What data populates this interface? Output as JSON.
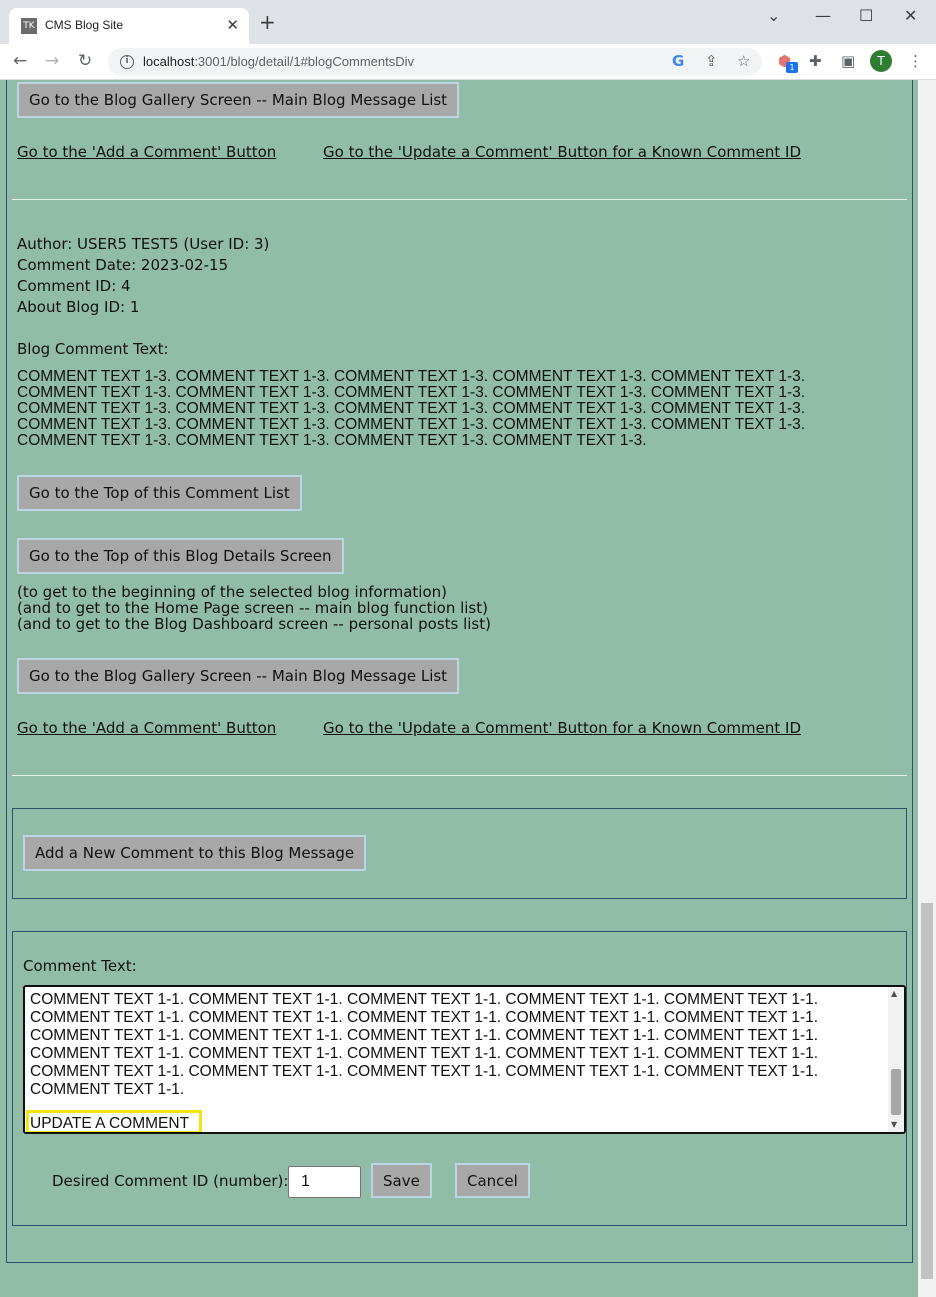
{
  "browser": {
    "tab_title": "CMS Blog Site",
    "tab_favicon": "TK",
    "url_host": "localhost",
    "url_rest": ":3001/blog/detail/1#blogCommentsDiv",
    "profile_initial": "T",
    "extension_badge": "1"
  },
  "nav_top": {
    "gallery_button": "Go to the Blog Gallery Screen -- Main Blog Message List",
    "add_comment_link": "Go to the 'Add a Comment' Button",
    "update_comment_link": "Go to the 'Update a Comment' Button for a Known Comment ID"
  },
  "comment": {
    "author": "Author: USER5 TEST5 (User ID: 3)",
    "date": "Comment Date: 2023-02-15",
    "comment_id": "Comment ID: 4",
    "blog_id": "About Blog ID: 1",
    "text_label": "Blog Comment Text:",
    "text": "COMMENT TEXT 1-3. COMMENT TEXT 1-3. COMMENT TEXT 1-3. COMMENT TEXT 1-3. COMMENT TEXT 1-3. COMMENT TEXT 1-3. COMMENT TEXT 1-3. COMMENT TEXT 1-3. COMMENT TEXT 1-3. COMMENT TEXT 1-3. COMMENT TEXT 1-3. COMMENT TEXT 1-3. COMMENT TEXT 1-3. COMMENT TEXT 1-3. COMMENT TEXT 1-3. COMMENT TEXT 1-3. COMMENT TEXT 1-3. COMMENT TEXT 1-3. COMMENT TEXT 1-3. COMMENT TEXT 1-3. COMMENT TEXT 1-3. COMMENT TEXT 1-3. COMMENT TEXT 1-3. COMMENT TEXT 1-3."
  },
  "nav_bottom": {
    "top_comment_list_button": "Go to the Top of this Comment List",
    "top_blog_details_button": "Go to the Top of this Blog Details Screen",
    "note_1": "(to get to the beginning of the selected blog information)",
    "note_2": "(and to get to the Home Page screen -- main blog function list)",
    "note_3": "(and to get to the Blog Dashboard screen -- personal posts list)",
    "gallery_button": "Go to the Blog Gallery Screen -- Main Blog Message List",
    "add_comment_link": "Go to the 'Add a Comment' Button",
    "update_comment_link": "Go to the 'Update a Comment' Button for a Known Comment ID"
  },
  "add_panel": {
    "add_button": "Add a New Comment to this Blog Message"
  },
  "update_panel": {
    "label": "Comment Text:",
    "textarea_text": "COMMENT TEXT 1-1. COMMENT TEXT 1-1. COMMENT TEXT 1-1. COMMENT TEXT 1-1. COMMENT TEXT 1-1. COMMENT TEXT 1-1. COMMENT TEXT 1-1. COMMENT TEXT 1-1. COMMENT TEXT 1-1. COMMENT TEXT 1-1. COMMENT TEXT 1-1. COMMENT TEXT 1-1. COMMENT TEXT 1-1. COMMENT TEXT 1-1. COMMENT TEXT 1-1. COMMENT TEXT 1-1. COMMENT TEXT 1-1. COMMENT TEXT 1-1. COMMENT TEXT 1-1. COMMENT TEXT 1-1. COMMENT TEXT 1-1. COMMENT TEXT 1-1. COMMENT TEXT 1-1. COMMENT TEXT 1-1. COMMENT TEXT 1-1. COMMENT TEXT 1-1.",
    "highlighted_text": "UPDATE A COMMENT",
    "id_label": "Desired Comment ID (number):",
    "id_value": "1",
    "save_button": "Save",
    "cancel_button": "Cancel"
  }
}
